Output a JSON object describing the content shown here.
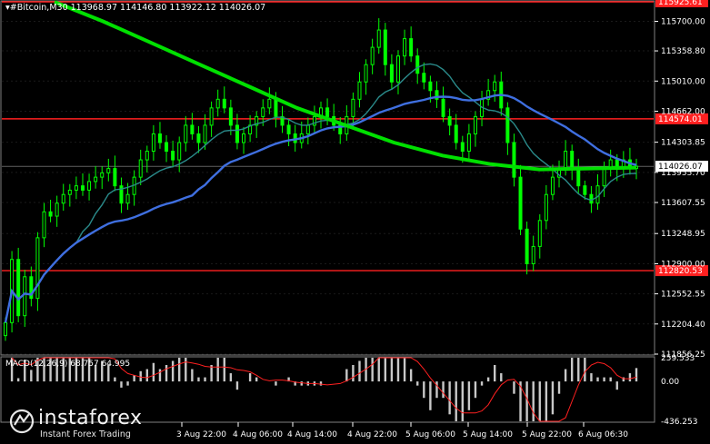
{
  "header": {
    "symbol_line": "▾#Bitcoin,M30  113968.97 114146.80 113922.12 114026.07"
  },
  "macd_header": "MACD(12,26,9) 68.757 64.995",
  "brand": {
    "name": "instaforex",
    "tagline": "Instant Forex Trading"
  },
  "colors": {
    "background": "#000000",
    "candles": "#00ff00",
    "ma_fast": "#00e000",
    "ma_blue": "#3f6fe0",
    "ma_teal": "#2a8a8a",
    "level": "#ff2020",
    "macd_hist": "#c8c8c8",
    "macd_signal": "#ff2020",
    "axis_text": "#ffffff"
  },
  "chart_data": {
    "type": "candlestick",
    "symbol": "#Bitcoin",
    "timeframe": "M30",
    "ylim": [
      111856.25,
      115925.61
    ],
    "price_ticks": [
      "115700.00",
      "115358.80",
      "115010.00",
      "114662.00",
      "114303.85",
      "113955.70",
      "113607.55",
      "113248.95",
      "112900.00",
      "112552.55",
      "112204.40",
      "111856.25"
    ],
    "x_tick_labels": [
      "3 Aug 22:00",
      "4 Aug 06:00",
      "4 Aug 14:00",
      "4 Aug 22:00",
      "5 Aug 06:00",
      "5 Aug 14:00",
      "5 Aug 22:00",
      "6 Aug 06:30"
    ],
    "levels": [
      {
        "price": 115925.61,
        "label": "115925.61"
      },
      {
        "price": 114574.01,
        "label": "114574.01"
      },
      {
        "price": 112820.53,
        "label": "112820.53"
      }
    ],
    "current_price": {
      "price": 114026.07,
      "label": "114026.07"
    },
    "close_prices": [
      112220,
      112950,
      112300,
      112750,
      112500,
      113200,
      113500,
      113450,
      113600,
      113700,
      113750,
      113800,
      113750,
      113850,
      113900,
      113950,
      114000,
      113800,
      113600,
      113700,
      113900,
      114100,
      114200,
      114400,
      114300,
      114200,
      114100,
      114300,
      114500,
      114400,
      114300,
      114500,
      114700,
      114800,
      114700,
      114500,
      114300,
      114400,
      114500,
      114600,
      114700,
      114800,
      114600,
      114500,
      114400,
      114300,
      114400,
      114500,
      114600,
      114700,
      114600,
      114500,
      114400,
      114600,
      114800,
      115000,
      115200,
      115400,
      115600,
      115200,
      115000,
      115300,
      115500,
      115300,
      115100,
      115000,
      114900,
      114800,
      114600,
      114500,
      114300,
      114200,
      114400,
      114600,
      114800,
      114900,
      115000,
      114700,
      114300,
      113900,
      113300,
      112900,
      113100,
      113400,
      113700,
      113900,
      114000,
      114200,
      114000,
      113800,
      113700,
      113600,
      113800,
      114000,
      114100,
      114000,
      114100,
      114000,
      114026
    ],
    "indicators": {
      "moving_averages": [
        "green",
        "blue",
        "teal"
      ],
      "macd": {
        "params": [
          12,
          26,
          9
        ],
        "main": 68.757,
        "signal": 64.995,
        "ticks": [
          "259.533",
          "0.00",
          "-436.253"
        ]
      }
    }
  }
}
